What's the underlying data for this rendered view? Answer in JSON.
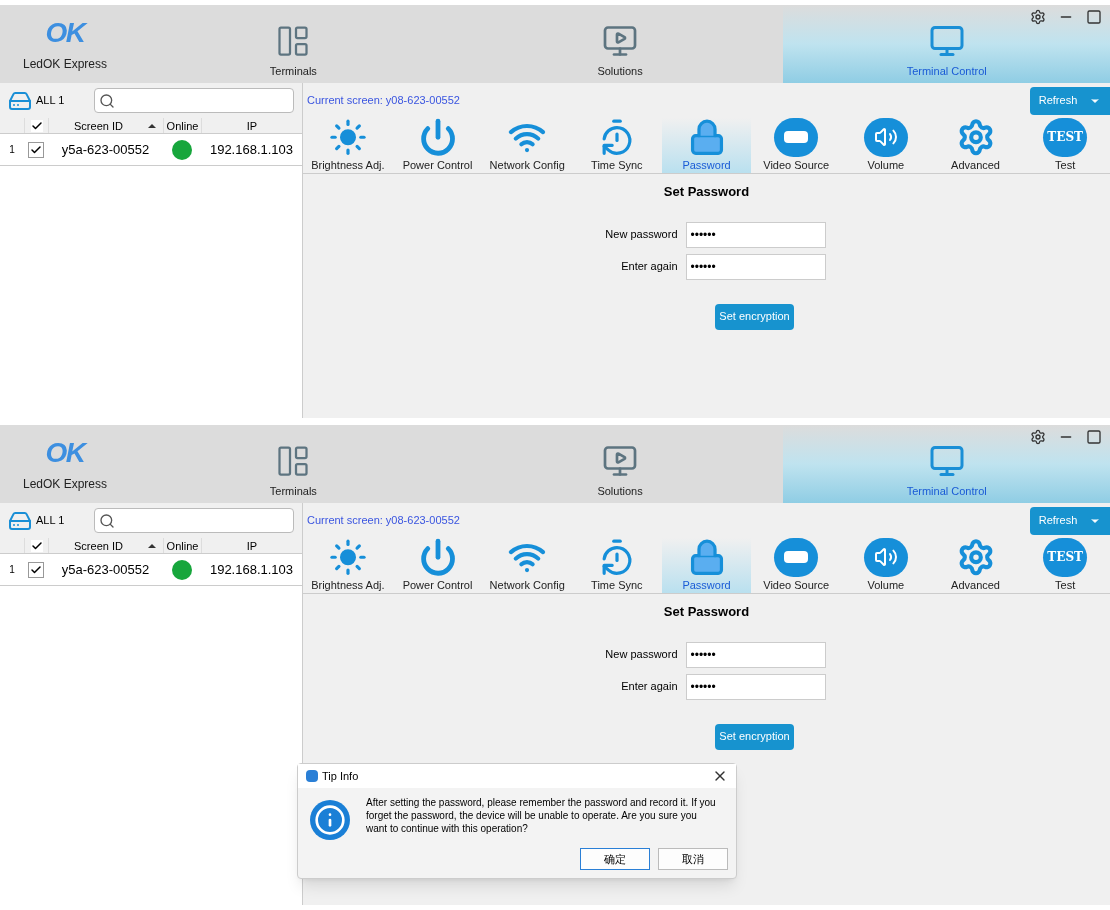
{
  "panels": [
    {
      "logo": "OK",
      "app_name": "LedOK Express",
      "tabs": [
        {
          "kind": "terminals",
          "label": "Terminals",
          "selected": false
        },
        {
          "kind": "solutions",
          "label": "Solutions",
          "selected": false
        },
        {
          "kind": "control",
          "label": "Terminal Control",
          "selected": true
        }
      ],
      "group_label": "ALL 1",
      "current_screen": "Current screen: y08-623-00552",
      "refresh": "Refresh",
      "table": {
        "header_checked": true,
        "columns": [
          "Screen ID",
          "Online",
          "IP"
        ],
        "rows": [
          {
            "index": "1",
            "checked": true,
            "screen_id": "y5a-623-00552",
            "online": true,
            "ip": "192.168.1.103"
          }
        ]
      },
      "tools": [
        {
          "kind": "brightness",
          "label": "Brightness Adj.",
          "selected": false
        },
        {
          "kind": "power",
          "label": "Power Control",
          "selected": false
        },
        {
          "kind": "network",
          "label": "Network Config",
          "selected": false
        },
        {
          "kind": "time",
          "label": "Time Sync",
          "selected": false
        },
        {
          "kind": "password",
          "label": "Password",
          "selected": true
        },
        {
          "kind": "video",
          "label": "Video Source",
          "selected": false
        },
        {
          "kind": "volume",
          "label": "Volume",
          "selected": false
        },
        {
          "kind": "advanced",
          "label": "Advanced",
          "selected": false
        },
        {
          "kind": "test",
          "label": "Test",
          "badge": "TEST",
          "selected": false
        }
      ],
      "form": {
        "title": "Set Password",
        "fields": [
          {
            "label": "New password",
            "value": "••••••"
          },
          {
            "label": "Enter again",
            "value": "••••••"
          }
        ],
        "button": "Set encryption"
      }
    },
    {
      "logo": "OK",
      "app_name": "LedOK Express",
      "tabs": [
        {
          "kind": "terminals",
          "label": "Terminals",
          "selected": false
        },
        {
          "kind": "solutions",
          "label": "Solutions",
          "selected": false
        },
        {
          "kind": "control",
          "label": "Terminal Control",
          "selected": true
        }
      ],
      "group_label": "ALL 1",
      "current_screen": "Current screen: y08-623-00552",
      "refresh": "Refresh",
      "table": {
        "header_checked": true,
        "columns": [
          "Screen ID",
          "Online",
          "IP"
        ],
        "rows": [
          {
            "index": "1",
            "checked": true,
            "screen_id": "y5a-623-00552",
            "online": true,
            "ip": "192.168.1.103"
          }
        ]
      },
      "tools": [
        {
          "kind": "brightness",
          "label": "Brightness Adj.",
          "selected": false
        },
        {
          "kind": "power",
          "label": "Power Control",
          "selected": false
        },
        {
          "kind": "network",
          "label": "Network Config",
          "selected": false
        },
        {
          "kind": "time",
          "label": "Time Sync",
          "selected": false
        },
        {
          "kind": "password",
          "label": "Password",
          "selected": true
        },
        {
          "kind": "video",
          "label": "Video Source",
          "selected": false
        },
        {
          "kind": "volume",
          "label": "Volume",
          "selected": false
        },
        {
          "kind": "advanced",
          "label": "Advanced",
          "selected": false
        },
        {
          "kind": "test",
          "label": "Test",
          "badge": "TEST",
          "selected": false
        }
      ],
      "form": {
        "title": "Set Password",
        "fields": [
          {
            "label": "New password",
            "value": "••••••"
          },
          {
            "label": "Enter again",
            "value": "••••••"
          }
        ],
        "button": "Set encryption"
      },
      "dialog": {
        "title": "Tip Info",
        "message": "After setting the password, please remember the password and record it. If you forget the password, the device will be unable to operate. Are you sure you want to continue with this operation?",
        "buttons": [
          {
            "label": "确定",
            "selected": true
          },
          {
            "label": "取消",
            "selected": false
          }
        ]
      }
    }
  ]
}
